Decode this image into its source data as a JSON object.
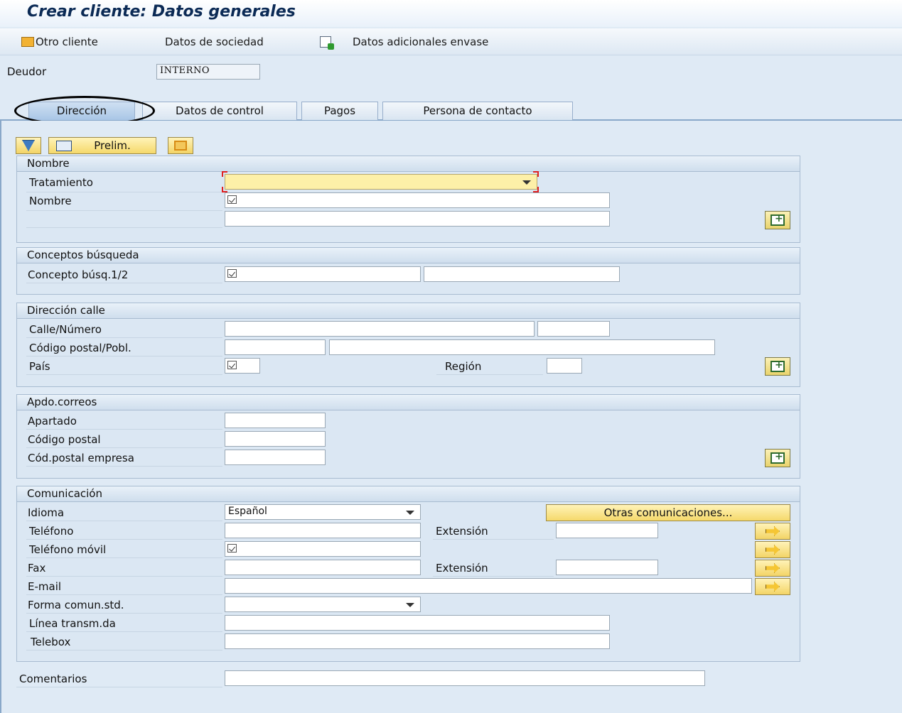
{
  "title": "Crear cliente: Datos generales",
  "toolbar": {
    "otro_cliente": "Otro cliente",
    "datos_sociedad": "Datos de sociedad",
    "datos_adicionales": "Datos adicionales envase"
  },
  "deudor": {
    "label": "Deudor",
    "value": "INTERNO"
  },
  "tabs": [
    "Dirección",
    "Datos de control",
    "Pagos",
    "Persona de contacto"
  ],
  "actions": {
    "prelim": "Prelim."
  },
  "nombre_group": {
    "title": "Nombre",
    "tratamiento": "Tratamiento",
    "nombre": "Nombre"
  },
  "busqueda_group": {
    "title": "Conceptos búsqueda",
    "concepto": "Concepto búsq.1/2"
  },
  "calle_group": {
    "title": "Dirección calle",
    "calle": "Calle/Número",
    "codigo_postal": "Código postal/Pobl.",
    "pais": "País",
    "region": "Región"
  },
  "apdo_group": {
    "title": "Apdo.correos",
    "apartado": "Apartado",
    "codigo_postal": "Código postal",
    "cod_empresa": "Cód.postal empresa"
  },
  "comunicacion_group": {
    "title": "Comunicación",
    "idioma": "Idioma",
    "idioma_value": "Español",
    "otras": "Otras comunicaciones...",
    "telefono": "Teléfono",
    "extension": "Extensión",
    "movil": "Teléfono móvil",
    "fax": "Fax",
    "extension2": "Extensión",
    "email": "E-mail",
    "forma": "Forma comun.std.",
    "linea": "Línea transm.da",
    "telebox": "Telebox"
  },
  "comentarios": "Comentarios"
}
